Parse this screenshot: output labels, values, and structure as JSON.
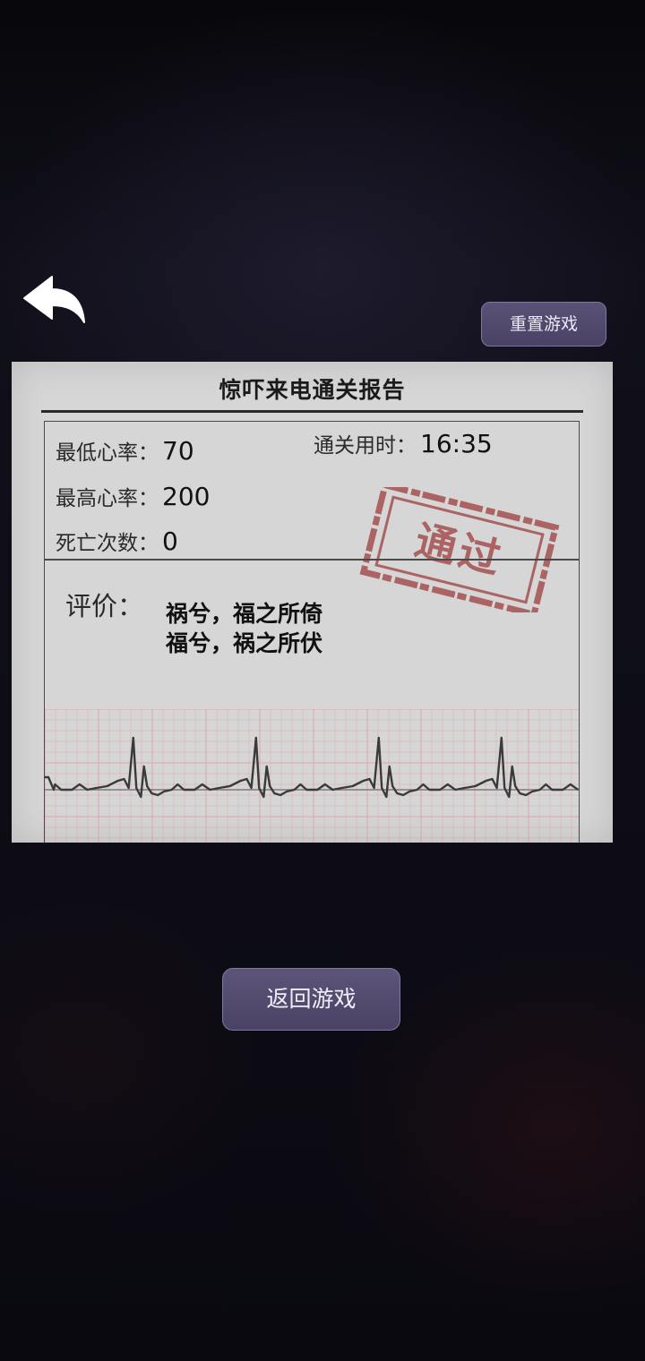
{
  "header": {
    "reset_label": "重置游戏"
  },
  "report": {
    "title": "惊吓来电通关报告",
    "stats": {
      "min_hr_label": "最低心率：",
      "min_hr_value": "70",
      "max_hr_label": "最高心率：",
      "max_hr_value": "200",
      "deaths_label": "死亡次数：",
      "deaths_value": "0",
      "time_label": "通关用时：",
      "time_value": "16:35"
    },
    "stamp_text": "通过",
    "evaluation": {
      "label": "评价：",
      "line1": "祸兮，福之所倚",
      "line2": "福兮，祸之所伏"
    }
  },
  "footer": {
    "return_label": "返回游戏"
  },
  "icons": {
    "back": "back-arrow-icon"
  },
  "colors": {
    "button_fill": "#4e4668",
    "button_border": "#7e76a0",
    "paper": "#d6d6d6",
    "stamp_red": "#a34a4a",
    "ecg_grid": "#d9a9a9",
    "ecg_line": "#3a3a3a"
  }
}
